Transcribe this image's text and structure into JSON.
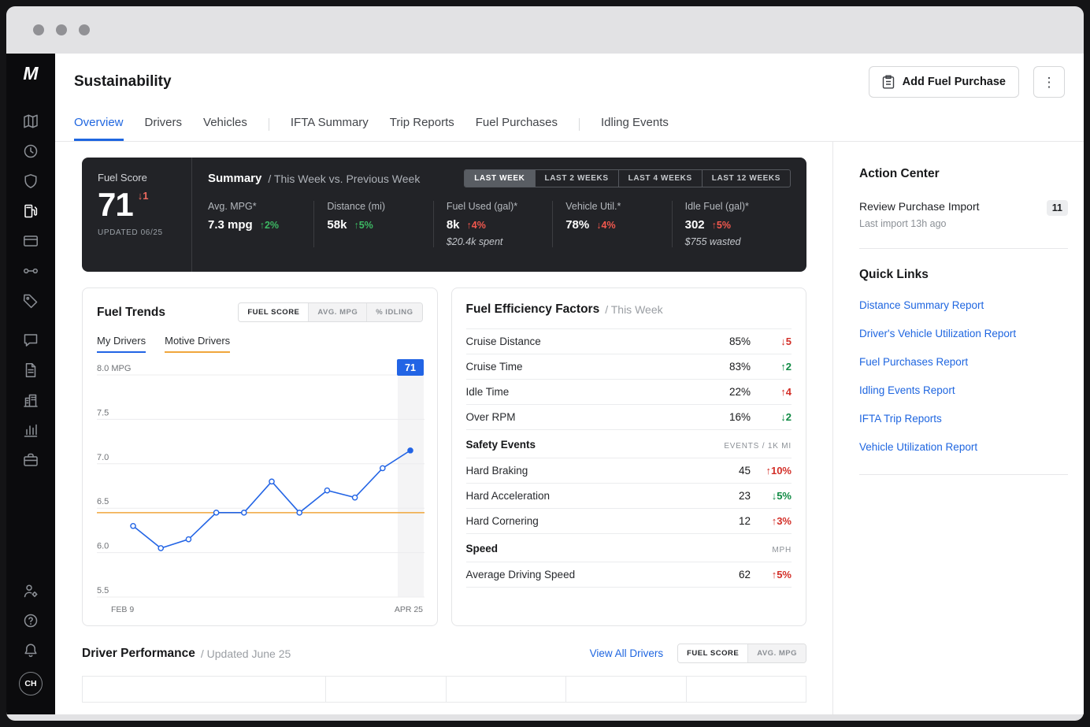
{
  "header": {
    "title": "Sustainability",
    "add_button": "Add Fuel Purchase",
    "more_button": "⋮"
  },
  "sidebar": {
    "logo": "M",
    "icons": [
      "map",
      "clock",
      "shield",
      "fuel",
      "card",
      "integrations",
      "tag",
      "chat",
      "document",
      "facility",
      "reports",
      "apps"
    ],
    "active_icon": "fuel",
    "gap_before": "chat",
    "bottom_icons": [
      "admin",
      "help",
      "notifications"
    ],
    "avatar": "CH"
  },
  "tabs": {
    "items": [
      "Overview",
      "Drivers",
      "Vehicles",
      "IFTA Summary",
      "Trip Reports",
      "Fuel Purchases",
      "Idling Events"
    ],
    "active": "Overview"
  },
  "summary": {
    "fuel_score_label": "Fuel Score",
    "score": "71",
    "score_delta": "↓1",
    "updated": "UPDATED 06/25",
    "title": "Summary",
    "subtitle": "/ This Week vs. Previous Week",
    "ranges": [
      "LAST WEEK",
      "LAST 2 WEEKS",
      "LAST 4 WEEKS",
      "LAST 12 WEEKS"
    ],
    "active_range": "LAST WEEK",
    "metrics": [
      {
        "label": "Avg. MPG*",
        "value": "7.3 mpg",
        "delta": "↑2%",
        "trend": "pos",
        "sub": ""
      },
      {
        "label": "Distance (mi)",
        "value": "58k",
        "delta": "↑5%",
        "trend": "pos",
        "sub": ""
      },
      {
        "label": "Fuel Used (gal)*",
        "value": "8k",
        "delta": "↑4%",
        "trend": "neg",
        "sub": "$20.4k spent"
      },
      {
        "label": "Vehicle Util.*",
        "value": "78%",
        "delta": "↓4%",
        "trend": "neg",
        "sub": ""
      },
      {
        "label": "Idle Fuel (gal)*",
        "value": "302",
        "delta": "↑5%",
        "trend": "neg",
        "sub": "$755 wasted"
      }
    ]
  },
  "fuel_trends": {
    "title": "Fuel Trends",
    "toggles": [
      "FUEL SCORE",
      "AVG. MPG",
      "% IDLING"
    ],
    "active_toggle": "FUEL SCORE",
    "legend": [
      "My Drivers",
      "Motive Drivers"
    ]
  },
  "chart_data": {
    "type": "line",
    "title": "Fuel Trends",
    "ylabel": "MPG",
    "ylim": [
      5.5,
      8.0
    ],
    "y_tick_values": [
      8.0,
      7.5,
      7.0,
      6.5,
      6.0,
      5.5
    ],
    "y_tick_labels": [
      "8.0 MPG",
      "7.5",
      "7.0",
      "6.5",
      "6.0",
      "5.5"
    ],
    "x_ticks": [
      "FEB 9",
      "APR 25"
    ],
    "series": [
      {
        "name": "My Drivers",
        "color": "#2264e5",
        "values": [
          6.3,
          6.05,
          6.15,
          6.45,
          6.45,
          6.8,
          6.45,
          6.7,
          6.62,
          6.95,
          7.15
        ]
      },
      {
        "name": "Motive Drivers",
        "color": "#f0a63c",
        "flat_value": 6.45
      }
    ],
    "badge": "71",
    "grid": true,
    "legend_position": "top-left"
  },
  "efficiency": {
    "title": "Fuel Efficiency Factors",
    "subtitle": "/ This Week",
    "rows": [
      {
        "label": "Cruise Distance",
        "value": "85%",
        "delta": "↓5",
        "trend": "neg"
      },
      {
        "label": "Cruise Time",
        "value": "83%",
        "delta": "↑2",
        "trend": "pos"
      },
      {
        "label": "Idle Time",
        "value": "22%",
        "delta": "↑4",
        "trend": "neg"
      },
      {
        "label": "Over RPM",
        "value": "16%",
        "delta": "↓2",
        "trend": "pos"
      }
    ],
    "safety_title": "Safety Events",
    "safety_unit": "EVENTS / 1K MI",
    "safety_rows": [
      {
        "label": "Hard Braking",
        "value": "45",
        "delta": "↑10%",
        "trend": "neg"
      },
      {
        "label": "Hard Acceleration",
        "value": "23",
        "delta": "↓5%",
        "trend": "pos"
      },
      {
        "label": "Hard Cornering",
        "value": "12",
        "delta": "↑3%",
        "trend": "neg"
      }
    ],
    "speed_title": "Speed",
    "speed_unit": "MPH",
    "speed_rows": [
      {
        "label": "Average Driving Speed",
        "value": "62",
        "delta": "↑5%",
        "trend": "neg"
      }
    ]
  },
  "driver_performance": {
    "title": "Driver Performance",
    "subtitle": "/ Updated June 25",
    "view_all": "View All Drivers",
    "toggles": [
      "FUEL SCORE",
      "AVG. MPG"
    ],
    "active_toggle": "FUEL SCORE"
  },
  "action_center": {
    "title": "Action Center",
    "item_title": "Review Purchase Import",
    "item_sub": "Last import 13h ago",
    "badge": "11"
  },
  "quick_links": {
    "title": "Quick Links",
    "links": [
      "Distance Summary Report",
      "Driver's Vehicle Utilization Report",
      "Fuel Purchases Report",
      "Idling Events Report",
      "IFTA Trip Reports",
      "Vehicle Utilization Report"
    ]
  }
}
